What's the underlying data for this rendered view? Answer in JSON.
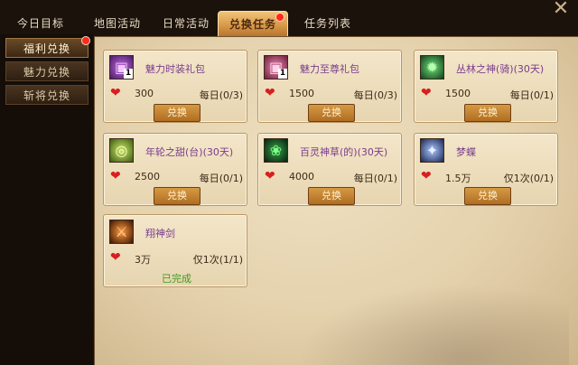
{
  "tabs": [
    {
      "label": "今日目标"
    },
    {
      "label": "地图活动"
    },
    {
      "label": "日常活动"
    },
    {
      "label": "兑换任务",
      "active": true,
      "badge": true
    },
    {
      "label": "任务列表"
    }
  ],
  "sidebar": [
    {
      "label": "福利兑换",
      "active": true,
      "badge": true
    },
    {
      "label": "魅力兑换"
    },
    {
      "label": "斩将兑换"
    }
  ],
  "items": [
    {
      "name": "魅力时装礼包",
      "qty": "1",
      "cost": "300",
      "limit": "每日(0/3)",
      "action": "兑换",
      "icon": "purple-giftbox-icon",
      "name_color": "purple"
    },
    {
      "name": "魅力至尊礼包",
      "qty": "1",
      "cost": "1500",
      "limit": "每日(0/3)",
      "action": "兑换",
      "icon": "pink-giftbox-icon",
      "name_color": "purple"
    },
    {
      "name": "丛林之神(骑)(30天)",
      "qty": "",
      "cost": "1500",
      "limit": "每日(0/1)",
      "action": "兑换",
      "icon": "green-beast-icon",
      "name_color": "purple"
    },
    {
      "name": "年轮之甜(台)(30天)",
      "qty": "",
      "cost": "2500",
      "limit": "每日(0/1)",
      "action": "兑换",
      "icon": "green-ring-icon",
      "name_color": "purple"
    },
    {
      "name": "百灵神草(的)(30天)",
      "qty": "",
      "cost": "4000",
      "limit": "每日(0/1)",
      "action": "兑换",
      "icon": "green-herb-icon",
      "name_color": "purple"
    },
    {
      "name": "梦蝶",
      "qty": "",
      "cost": "1.5万",
      "limit": "仅1次(0/1)",
      "action": "兑换",
      "icon": "butterfly-icon",
      "name_color": "purple"
    },
    {
      "name": "翔神剑",
      "qty": "",
      "cost": "3万",
      "limit": "仅1次(1/1)",
      "action": "",
      "status": "已完成",
      "icon": "fire-sword-icon",
      "name_color": "purple"
    }
  ],
  "currency_icon": "heart-icon",
  "close_icon": "close-icon"
}
